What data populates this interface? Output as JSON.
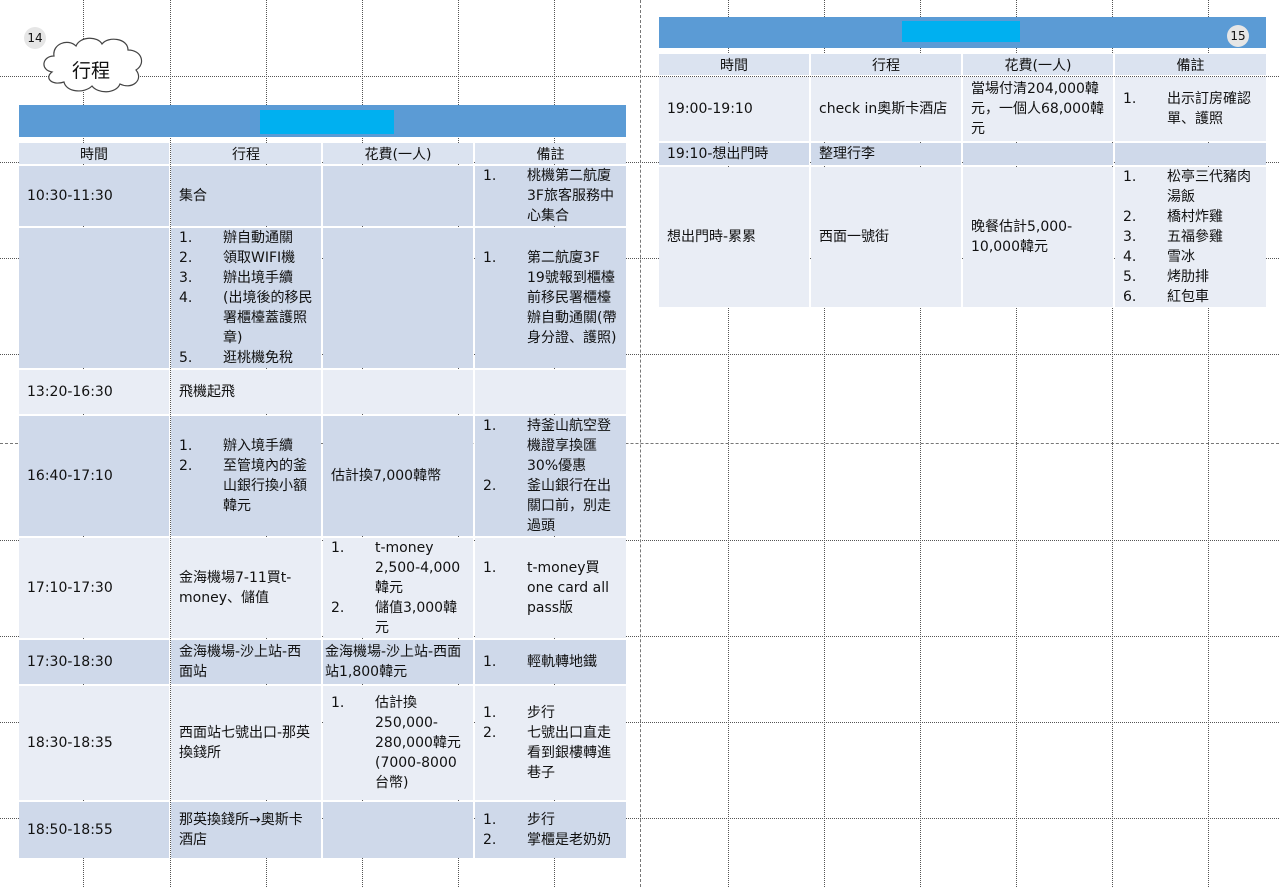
{
  "left": {
    "page_number": "14",
    "cloud_label": "行程",
    "headers": [
      "時間",
      "行程",
      "花費(一人)",
      "備註"
    ],
    "rows": [
      {
        "time": "10:30-11:30",
        "plan": "集合",
        "plan_items": [],
        "cost": "",
        "cost_items": [],
        "note_items": [
          "桃機第二航廈3F旅客服務中心集合"
        ]
      },
      {
        "time": "",
        "plan": "",
        "plan_items": [
          "辦自動通關",
          "領取WIFI機",
          "辦出境手續 (出境後的移民署櫃檯蓋護照章)",
          "",
          "逛桃機免稅"
        ],
        "cost": "",
        "cost_items": [],
        "note_items": [
          "第二航廈3F 19號報到櫃檯前移民署櫃檯辦自動通關(帶身分證、護照)"
        ]
      },
      {
        "time": "13:20-16:30",
        "plan": "飛機起飛",
        "plan_items": [],
        "cost": "",
        "cost_items": [],
        "note_items": []
      },
      {
        "time": "16:40-17:10",
        "plan": "",
        "plan_items": [
          "辦入境手續",
          "至管境內的釜山銀行換小額韓元"
        ],
        "cost": "估計換7,000韓幣",
        "cost_items": [],
        "note_items": [
          "持釜山航空登機證享換匯30%優惠",
          "釜山銀行在出關口前，別走過頭"
        ]
      },
      {
        "time": "17:10-17:30",
        "plan": "金海機場7-11買t-money、儲值",
        "plan_items": [],
        "cost": "",
        "cost_items": [
          "t-money 2,500-4,000韓元",
          "儲值3,000韓元"
        ],
        "note_items": [
          "t-money買one card all pass版"
        ]
      },
      {
        "time": "17:30-18:30",
        "plan": "金海機場-沙上站-西面站",
        "plan_items": [],
        "cost": "金海機場-沙上站-西面站1,800韓元",
        "cost_items": [],
        "note_items": [
          "輕軌轉地鐵"
        ]
      },
      {
        "time": "18:30-18:35",
        "plan": "西面站七號出口-那英換錢所",
        "plan_items": [],
        "cost": "",
        "cost_items": [
          "估計換250,000-280,000韓元(7000-8000台幣)"
        ],
        "note_items": [
          "步行",
          "七號出口直走看到銀樓轉進巷子"
        ]
      },
      {
        "time": "18:50-18:55",
        "plan": "那英換錢所→奧斯卡酒店",
        "plan_items": [],
        "cost": "",
        "cost_items": [],
        "note_items": [
          "步行",
          "掌櫃是老奶奶"
        ]
      }
    ]
  },
  "right": {
    "page_number": "15",
    "headers": [
      "時間",
      "行程",
      "花費(一人)",
      "備註"
    ],
    "rows": [
      {
        "time": "19:00-19:10",
        "plan": "check in奧斯卡酒店",
        "plan_items": [],
        "cost": "當場付清204,000韓元，一個人68,000韓元",
        "cost_items": [],
        "note_items": [
          "出示訂房確認單、護照"
        ]
      },
      {
        "time": "19:10-想出門時",
        "plan": "整理行李",
        "plan_items": [],
        "cost": "",
        "cost_items": [],
        "note_items": []
      },
      {
        "time": "想出門時-累累",
        "plan": "西面一號街",
        "plan_items": [],
        "cost": "晚餐估計5,000-10,000韓元",
        "cost_items": [],
        "note_items": [
          "松亭三代豬肉湯飯",
          "橋村炸雞",
          "五福參雞",
          "雪冰",
          "烤肋排",
          "紅包車"
        ]
      }
    ]
  }
}
